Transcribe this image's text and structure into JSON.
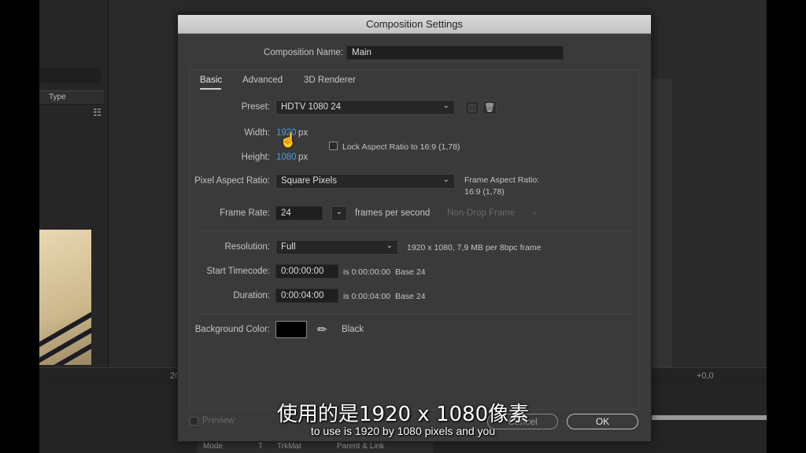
{
  "background_app": {
    "column_type_label": "Type",
    "bottom_bar": {
      "left_value": "20",
      "right_value": "+0,0"
    },
    "timeline_headers": [
      "Mode",
      "T",
      "TrkMat",
      "Parent & Link"
    ]
  },
  "dialog": {
    "title": "Composition Settings",
    "comp_name_label": "Composition Name:",
    "comp_name_value": "Main",
    "tabs": [
      {
        "label": "Basic",
        "active": true
      },
      {
        "label": "Advanced",
        "active": false
      },
      {
        "label": "3D Renderer",
        "active": false
      }
    ],
    "preset_label": "Preset:",
    "preset_value": "HDTV 1080 24",
    "width_label": "Width:",
    "width_value": "1920",
    "width_unit": "px",
    "height_label": "Height:",
    "height_value": "1080",
    "height_unit": "px",
    "lock_aspect_label": "Lock Aspect Ratio to 16:9 (1,78)",
    "pixel_aspect_label": "Pixel Aspect Ratio:",
    "pixel_aspect_value": "Square Pixels",
    "frame_aspect_label": "Frame Aspect Ratio:",
    "frame_aspect_value": "16:9 (1,78)",
    "frame_rate_label": "Frame Rate:",
    "frame_rate_value": "24",
    "frames_per_second": "frames per second",
    "drop_frame_value": "Non-Drop Frame",
    "resolution_label": "Resolution:",
    "resolution_value": "Full",
    "resolution_info": "1920 x 1080, 7,9 MB per 8bpc frame",
    "start_tc_label": "Start Timecode:",
    "start_tc_value": "0:00:00:00",
    "start_tc_info": "is 0:00:00:00  Base 24",
    "duration_label": "Duration:",
    "duration_value": "0:00:04:00",
    "duration_info": "is 0:00:04:00  Base 24",
    "bg_color_label": "Background Color:",
    "bg_color_name": "Black",
    "bg_color_hex": "#000000",
    "preview_label": "Preview",
    "cancel_label": "Cancel",
    "ok_label": "OK"
  },
  "subtitles": {
    "chinese": "使用的是1920 x 1080像素",
    "english": "to use is 1920 by 1080 pixels and you"
  },
  "colors": {
    "accent_blue": "#4a9ce8",
    "dialog_bg": "#3a3a3a"
  }
}
